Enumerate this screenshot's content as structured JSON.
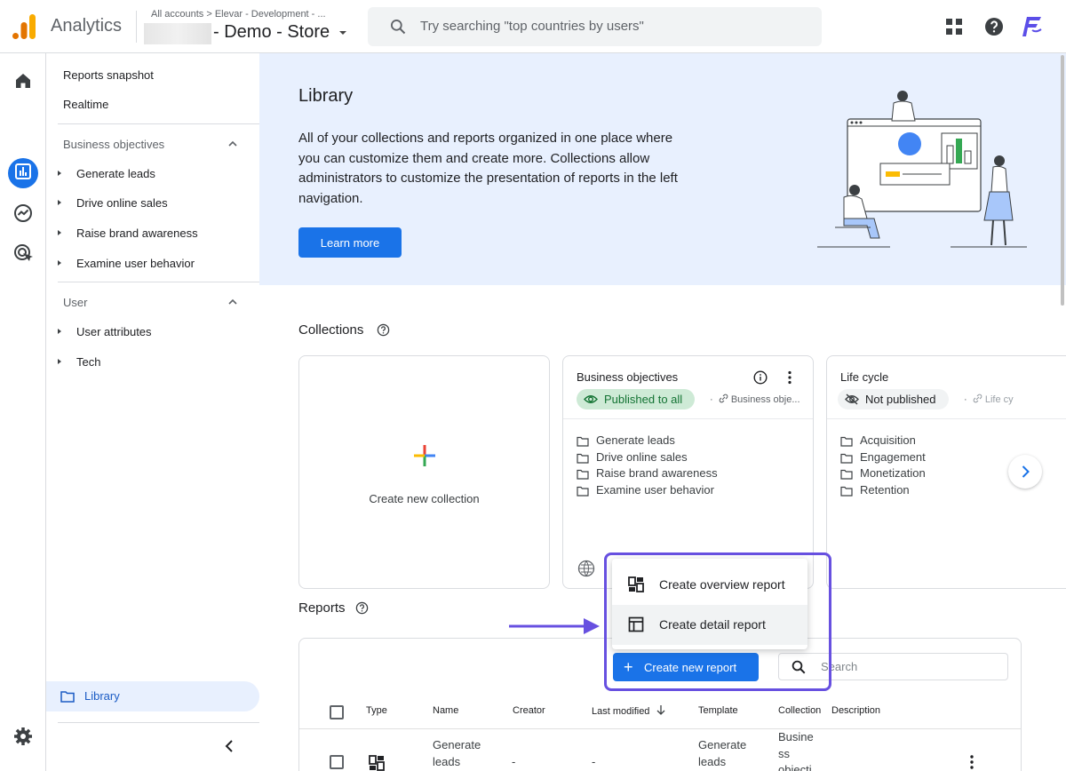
{
  "header": {
    "app_title": "Analytics",
    "breadcrumb": "All accounts  >  Elevar - Development - ...",
    "property_name": "- Demo - Store",
    "search_placeholder": "Try searching \"top countries by users\""
  },
  "nav": {
    "reports_snapshot": "Reports snapshot",
    "realtime": "Realtime",
    "business_objectives": {
      "heading": "Business objectives",
      "items": [
        "Generate leads",
        "Drive online sales",
        "Raise brand awareness",
        "Examine user behavior"
      ]
    },
    "user": {
      "heading": "User",
      "items": [
        "User attributes",
        "Tech"
      ]
    },
    "library": "Library"
  },
  "hero": {
    "title": "Library",
    "description": "All of your collections and reports organized in one place where you can customize them and create more. Collections allow administrators to customize the presentation of reports in the left navigation.",
    "learn_more": "Learn more"
  },
  "collections": {
    "title": "Collections",
    "create_label": "Create new collection",
    "cards": [
      {
        "title": "Business objectives",
        "status": "Published to all",
        "meta": "Business obje...",
        "items": [
          "Generate leads",
          "Drive online sales",
          "Raise brand awareness",
          "Examine user behavior"
        ]
      },
      {
        "title": "Life cycle",
        "status": "Not published",
        "meta": "Life cy",
        "items": [
          "Acquisition",
          "Engagement",
          "Monetization",
          "Retention"
        ]
      }
    ]
  },
  "reports": {
    "title": "Reports",
    "create_button": "Create new report",
    "search_placeholder": "Search",
    "menu": {
      "overview": "Create overview report",
      "detail": "Create detail report"
    },
    "columns": {
      "type": "Type",
      "name": "Name",
      "creator": "Creator",
      "last_modified": "Last modified",
      "template": "Template",
      "collection": "Collection",
      "description": "Description"
    },
    "rows": [
      {
        "name_line1": "Generate",
        "name_line2": "leads",
        "creator": "-",
        "last_modified": "-",
        "template_line1": "Generate",
        "template_line2": "leads",
        "collection_line1": "Busine",
        "collection_line2": "ss",
        "collection_line3": "objecti"
      }
    ]
  },
  "colors": {
    "primary": "#1a73e8",
    "highlight": "#6750e0",
    "published_bg": "#ceead6",
    "published_text": "#137333"
  }
}
